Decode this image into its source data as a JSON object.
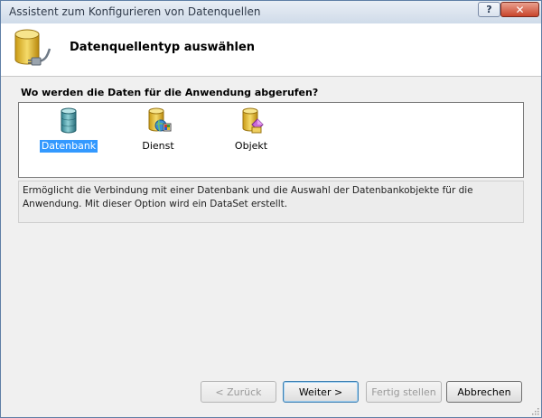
{
  "window": {
    "title": "Assistent zum Konfigurieren von Datenquellen",
    "help_label": "?",
    "close_label": "✕"
  },
  "header": {
    "title": "Datenquellentyp auswählen",
    "icon": "database-connector-icon"
  },
  "question": "Wo werden die Daten für die Anwendung abgerufen?",
  "source_types": [
    {
      "label": "Datenbank",
      "icon": "database-cylinder-icon",
      "selected": true
    },
    {
      "label": "Dienst",
      "icon": "database-service-icon",
      "selected": false
    },
    {
      "label": "Objekt",
      "icon": "database-object-icon",
      "selected": false
    }
  ],
  "description": "Ermöglicht die Verbindung mit einer Datenbank und die Auswahl der Datenbankobjekte für die Anwendung. Mit dieser Option wird ein DataSet erstellt.",
  "buttons": {
    "back": "< Zurück",
    "next": "Weiter >",
    "finish": "Fertig stellen",
    "cancel": "Abbrechen"
  },
  "colors": {
    "selection": "#3399ff",
    "titlebar": "#cfdbe9",
    "close": "#c9442b",
    "database_gold": "#e8c13a",
    "database_teal": "#4a9aa8"
  }
}
